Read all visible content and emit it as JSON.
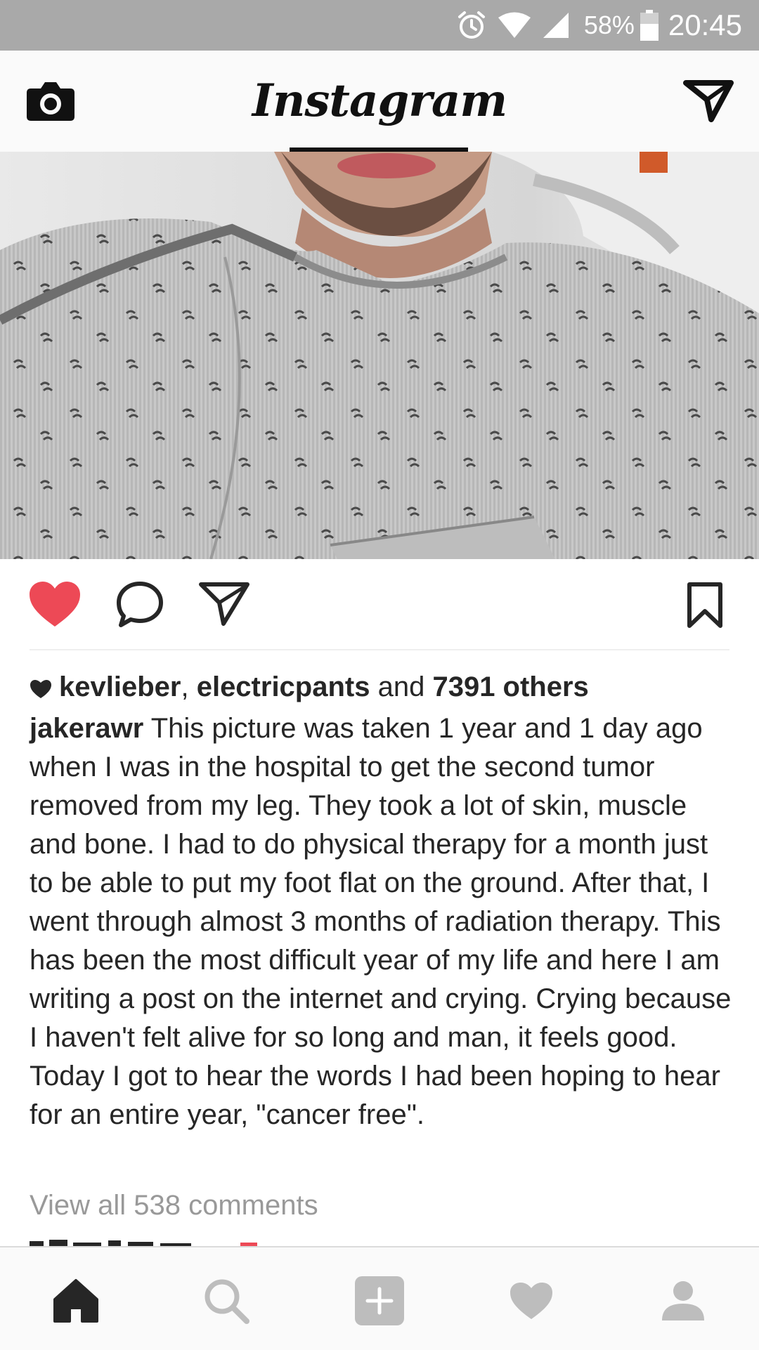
{
  "status_bar": {
    "battery_percent": "58%",
    "time": "20:45",
    "icons": [
      "alarm-icon",
      "wifi-icon",
      "signal-icon",
      "battery-icon"
    ]
  },
  "header": {
    "logo_text": "Instagram",
    "left_icon": "camera-icon",
    "right_icon": "direct-message-icon"
  },
  "post": {
    "liked": true,
    "likes": {
      "user1": "kevlieber",
      "separator": ", ",
      "user2": "electricpants",
      "and_text": " and ",
      "others": "7391 others"
    },
    "caption": {
      "username": "jakerawr",
      "text": "This picture was taken 1 year and 1 day ago when I was in the hospital to get the second tumor removed from my leg. They took a lot of skin, muscle and bone. I had to do physical therapy for a month just to be able to put my foot flat on the ground. After that, I went through almost 3 months of radiation therapy. This has been the most difficult year of my life and here I am writing a post on the internet and crying. Crying because I haven't felt alive for so long and man, it feels good. Today I got to hear the words I had been hoping to hear for an entire year, \"cancer free\"."
    },
    "view_comments": "View all 538 comments"
  },
  "bottom_nav": {
    "items": [
      "home-icon",
      "search-icon",
      "add-post-icon",
      "activity-heart-icon",
      "profile-icon"
    ],
    "active": "home-icon"
  },
  "colors": {
    "like_red": "#ed4956",
    "status_bar_gray": "#a9a9a9",
    "muted_text": "#999999"
  }
}
